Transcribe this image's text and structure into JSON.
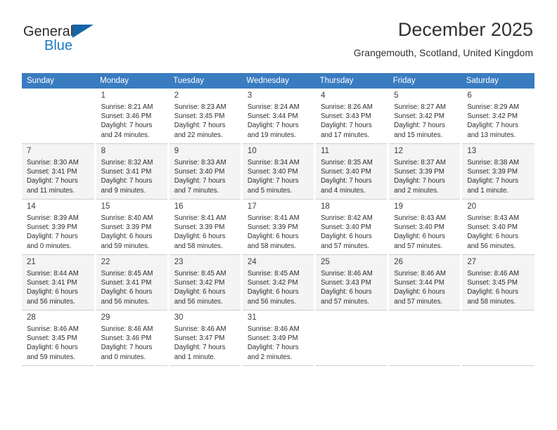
{
  "brand": {
    "name_part1": "General",
    "name_part2": "Blue",
    "flag_icon": "triangle-flag-icon",
    "colors": {
      "blue": "#1a7bc4",
      "flag": "#1565a8",
      "dark": "#2b2b2b"
    }
  },
  "header": {
    "title": "December 2025",
    "subtitle": "Grangemouth, Scotland, United Kingdom"
  },
  "calendar": {
    "header_background": "#3a7cc0",
    "weekdays": [
      "Sunday",
      "Monday",
      "Tuesday",
      "Wednesday",
      "Thursday",
      "Friday",
      "Saturday"
    ],
    "weeks": [
      [
        {
          "day": "",
          "sunrise": "",
          "sunset": "",
          "daylight1": "",
          "daylight2": ""
        },
        {
          "day": "1",
          "sunrise": "Sunrise: 8:21 AM",
          "sunset": "Sunset: 3:46 PM",
          "daylight1": "Daylight: 7 hours",
          "daylight2": "and 24 minutes."
        },
        {
          "day": "2",
          "sunrise": "Sunrise: 8:23 AM",
          "sunset": "Sunset: 3:45 PM",
          "daylight1": "Daylight: 7 hours",
          "daylight2": "and 22 minutes."
        },
        {
          "day": "3",
          "sunrise": "Sunrise: 8:24 AM",
          "sunset": "Sunset: 3:44 PM",
          "daylight1": "Daylight: 7 hours",
          "daylight2": "and 19 minutes."
        },
        {
          "day": "4",
          "sunrise": "Sunrise: 8:26 AM",
          "sunset": "Sunset: 3:43 PM",
          "daylight1": "Daylight: 7 hours",
          "daylight2": "and 17 minutes."
        },
        {
          "day": "5",
          "sunrise": "Sunrise: 8:27 AM",
          "sunset": "Sunset: 3:42 PM",
          "daylight1": "Daylight: 7 hours",
          "daylight2": "and 15 minutes."
        },
        {
          "day": "6",
          "sunrise": "Sunrise: 8:29 AM",
          "sunset": "Sunset: 3:42 PM",
          "daylight1": "Daylight: 7 hours",
          "daylight2": "and 13 minutes."
        }
      ],
      [
        {
          "day": "7",
          "sunrise": "Sunrise: 8:30 AM",
          "sunset": "Sunset: 3:41 PM",
          "daylight1": "Daylight: 7 hours",
          "daylight2": "and 11 minutes."
        },
        {
          "day": "8",
          "sunrise": "Sunrise: 8:32 AM",
          "sunset": "Sunset: 3:41 PM",
          "daylight1": "Daylight: 7 hours",
          "daylight2": "and 9 minutes."
        },
        {
          "day": "9",
          "sunrise": "Sunrise: 8:33 AM",
          "sunset": "Sunset: 3:40 PM",
          "daylight1": "Daylight: 7 hours",
          "daylight2": "and 7 minutes."
        },
        {
          "day": "10",
          "sunrise": "Sunrise: 8:34 AM",
          "sunset": "Sunset: 3:40 PM",
          "daylight1": "Daylight: 7 hours",
          "daylight2": "and 5 minutes."
        },
        {
          "day": "11",
          "sunrise": "Sunrise: 8:35 AM",
          "sunset": "Sunset: 3:40 PM",
          "daylight1": "Daylight: 7 hours",
          "daylight2": "and 4 minutes."
        },
        {
          "day": "12",
          "sunrise": "Sunrise: 8:37 AM",
          "sunset": "Sunset: 3:39 PM",
          "daylight1": "Daylight: 7 hours",
          "daylight2": "and 2 minutes."
        },
        {
          "day": "13",
          "sunrise": "Sunrise: 8:38 AM",
          "sunset": "Sunset: 3:39 PM",
          "daylight1": "Daylight: 7 hours",
          "daylight2": "and 1 minute."
        }
      ],
      [
        {
          "day": "14",
          "sunrise": "Sunrise: 8:39 AM",
          "sunset": "Sunset: 3:39 PM",
          "daylight1": "Daylight: 7 hours",
          "daylight2": "and 0 minutes."
        },
        {
          "day": "15",
          "sunrise": "Sunrise: 8:40 AM",
          "sunset": "Sunset: 3:39 PM",
          "daylight1": "Daylight: 6 hours",
          "daylight2": "and 59 minutes."
        },
        {
          "day": "16",
          "sunrise": "Sunrise: 8:41 AM",
          "sunset": "Sunset: 3:39 PM",
          "daylight1": "Daylight: 6 hours",
          "daylight2": "and 58 minutes."
        },
        {
          "day": "17",
          "sunrise": "Sunrise: 8:41 AM",
          "sunset": "Sunset: 3:39 PM",
          "daylight1": "Daylight: 6 hours",
          "daylight2": "and 58 minutes."
        },
        {
          "day": "18",
          "sunrise": "Sunrise: 8:42 AM",
          "sunset": "Sunset: 3:40 PM",
          "daylight1": "Daylight: 6 hours",
          "daylight2": "and 57 minutes."
        },
        {
          "day": "19",
          "sunrise": "Sunrise: 8:43 AM",
          "sunset": "Sunset: 3:40 PM",
          "daylight1": "Daylight: 6 hours",
          "daylight2": "and 57 minutes."
        },
        {
          "day": "20",
          "sunrise": "Sunrise: 8:43 AM",
          "sunset": "Sunset: 3:40 PM",
          "daylight1": "Daylight: 6 hours",
          "daylight2": "and 56 minutes."
        }
      ],
      [
        {
          "day": "21",
          "sunrise": "Sunrise: 8:44 AM",
          "sunset": "Sunset: 3:41 PM",
          "daylight1": "Daylight: 6 hours",
          "daylight2": "and 56 minutes."
        },
        {
          "day": "22",
          "sunrise": "Sunrise: 8:45 AM",
          "sunset": "Sunset: 3:41 PM",
          "daylight1": "Daylight: 6 hours",
          "daylight2": "and 56 minutes."
        },
        {
          "day": "23",
          "sunrise": "Sunrise: 8:45 AM",
          "sunset": "Sunset: 3:42 PM",
          "daylight1": "Daylight: 6 hours",
          "daylight2": "and 56 minutes."
        },
        {
          "day": "24",
          "sunrise": "Sunrise: 8:45 AM",
          "sunset": "Sunset: 3:42 PM",
          "daylight1": "Daylight: 6 hours",
          "daylight2": "and 56 minutes."
        },
        {
          "day": "25",
          "sunrise": "Sunrise: 8:46 AM",
          "sunset": "Sunset: 3:43 PM",
          "daylight1": "Daylight: 6 hours",
          "daylight2": "and 57 minutes."
        },
        {
          "day": "26",
          "sunrise": "Sunrise: 8:46 AM",
          "sunset": "Sunset: 3:44 PM",
          "daylight1": "Daylight: 6 hours",
          "daylight2": "and 57 minutes."
        },
        {
          "day": "27",
          "sunrise": "Sunrise: 8:46 AM",
          "sunset": "Sunset: 3:45 PM",
          "daylight1": "Daylight: 6 hours",
          "daylight2": "and 58 minutes."
        }
      ],
      [
        {
          "day": "28",
          "sunrise": "Sunrise: 8:46 AM",
          "sunset": "Sunset: 3:45 PM",
          "daylight1": "Daylight: 6 hours",
          "daylight2": "and 59 minutes."
        },
        {
          "day": "29",
          "sunrise": "Sunrise: 8:46 AM",
          "sunset": "Sunset: 3:46 PM",
          "daylight1": "Daylight: 7 hours",
          "daylight2": "and 0 minutes."
        },
        {
          "day": "30",
          "sunrise": "Sunrise: 8:46 AM",
          "sunset": "Sunset: 3:47 PM",
          "daylight1": "Daylight: 7 hours",
          "daylight2": "and 1 minute."
        },
        {
          "day": "31",
          "sunrise": "Sunrise: 8:46 AM",
          "sunset": "Sunset: 3:49 PM",
          "daylight1": "Daylight: 7 hours",
          "daylight2": "and 2 minutes."
        },
        {
          "day": "",
          "sunrise": "",
          "sunset": "",
          "daylight1": "",
          "daylight2": ""
        },
        {
          "day": "",
          "sunrise": "",
          "sunset": "",
          "daylight1": "",
          "daylight2": ""
        },
        {
          "day": "",
          "sunrise": "",
          "sunset": "",
          "daylight1": "",
          "daylight2": ""
        }
      ]
    ]
  }
}
